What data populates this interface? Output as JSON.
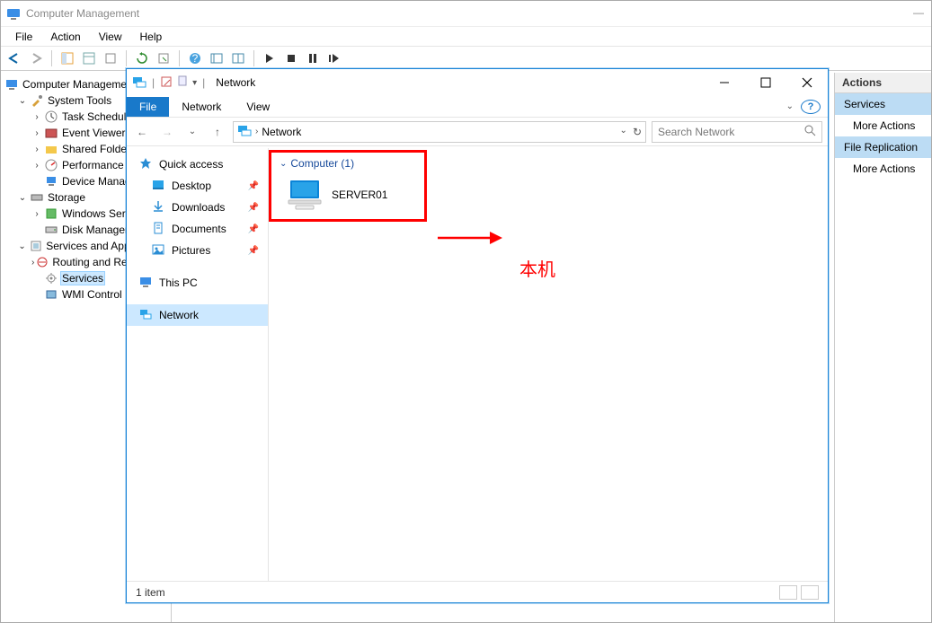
{
  "cm": {
    "title": "Computer Management",
    "menus": [
      "File",
      "Action",
      "View",
      "Help"
    ],
    "tree": {
      "root": "Computer Management",
      "system_tools": "System Tools",
      "task_scheduler": "Task Scheduler",
      "event_viewer": "Event Viewer",
      "shared_folders": "Shared Folders",
      "performance": "Performance",
      "device_manager": "Device Manager",
      "storage": "Storage",
      "windows_server": "Windows Server",
      "disk_management": "Disk Management",
      "services_apps": "Services and Applications",
      "routing": "Routing and Remote Access",
      "services": "Services",
      "wmi": "WMI Control"
    },
    "actions": {
      "header": "Actions",
      "services": "Services",
      "more1": "More Actions",
      "file_replication": "File Replication",
      "more2": "More Actions"
    },
    "titlebar_min": "—"
  },
  "explorer": {
    "title": "Network",
    "ribbon": {
      "file": "File",
      "network": "Network",
      "view": "View"
    },
    "breadcrumb": "Network",
    "search_placeholder": "Search Network",
    "nav": {
      "quick_access": "Quick access",
      "desktop": "Desktop",
      "downloads": "Downloads",
      "documents": "Documents",
      "pictures": "Pictures",
      "this_pc": "This PC",
      "network": "Network"
    },
    "group": "Computer (1)",
    "computer_name": "SERVER01",
    "status": "1 item"
  },
  "annotation": {
    "label": "本机"
  }
}
